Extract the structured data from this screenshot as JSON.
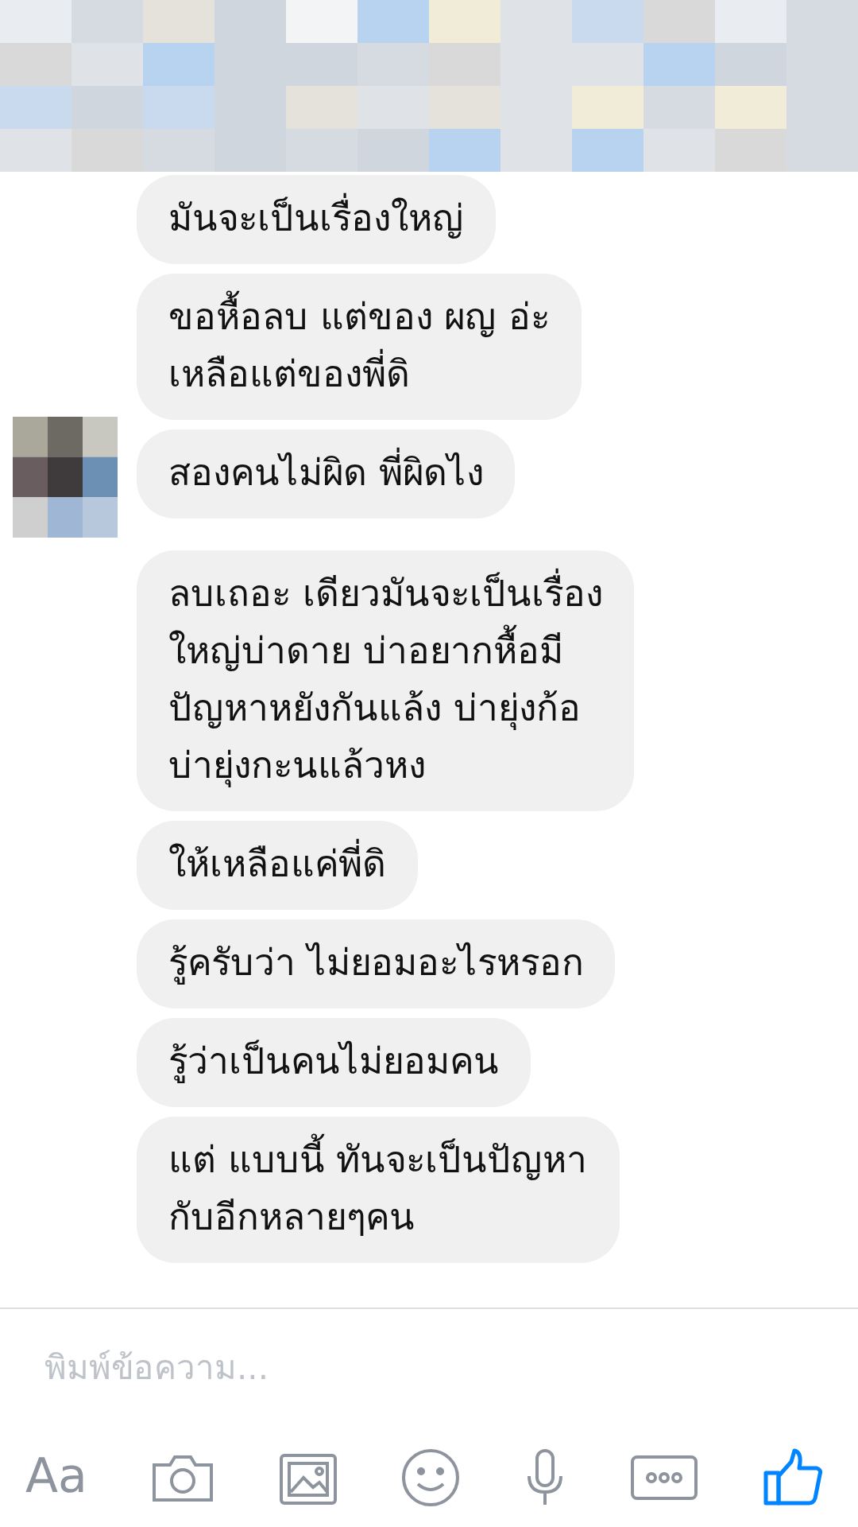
{
  "groups": [
    {
      "avatar": true,
      "messages": [
        "มันจะเป็นเรื่องใหญ่",
        "ขอหื้อลบ แต่ของ ผญ อ่ะ\nเหลือแต่ของพี่ดิ",
        "สองคนไม่ผิด พี่ผิดไง"
      ]
    },
    {
      "avatar": false,
      "messages": [
        "ลบเถอะ เดียวมันจะเป็นเรื่อง\nใหญ่บ่าดาย บ่าอยากหื้อมี\nปัญหาหยังกันแล้ง บ่ายุ่งก้อ\nบ่ายุ่งกะนแล้วหง",
        "ให้เหลือแค่พี่ดิ",
        "รู้ครับว่า ไม่ยอมอะไรหรอก",
        "รู้ว่าเป็นคนไม่ยอมคน",
        "แต่ แบบนี้ ทันจะเป็นปัญหา\nกับอีกหลายๆคน"
      ]
    }
  ],
  "composer": {
    "placeholder": "พิมพ์ข้อความ..."
  },
  "toolbar": {
    "text_button": "Aa"
  }
}
